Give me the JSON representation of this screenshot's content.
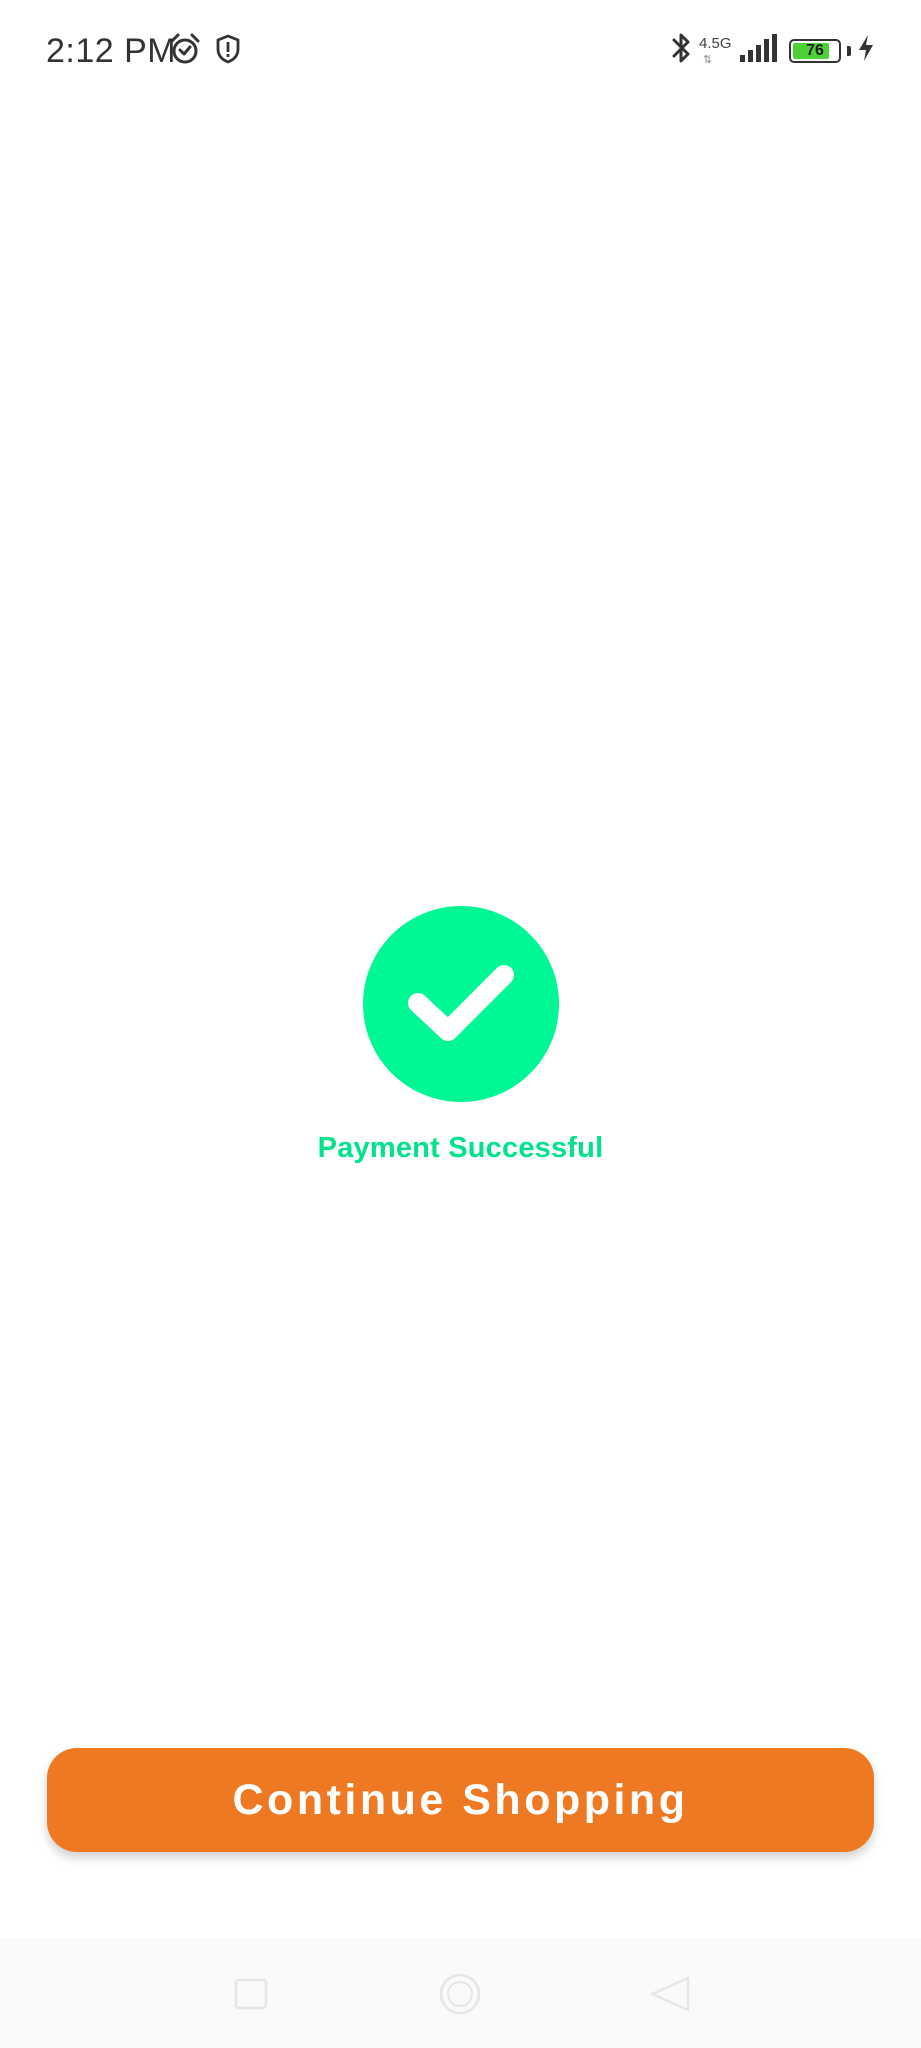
{
  "status_bar": {
    "time": "2:12 PM",
    "network_type": "4.5G",
    "battery_level": "76",
    "icons": [
      "alarm-icon",
      "shield-icon",
      "bluetooth-icon",
      "signal-icon",
      "battery-icon",
      "charging-icon"
    ]
  },
  "success": {
    "icon": "checkmark-icon",
    "message": "Payment Successful",
    "accent_color": "#00f894"
  },
  "actions": {
    "continue_label": "Continue Shopping",
    "button_color": "#ef7822"
  },
  "nav_bar": {
    "icons": [
      "recent-apps-icon",
      "home-icon",
      "back-icon"
    ]
  }
}
